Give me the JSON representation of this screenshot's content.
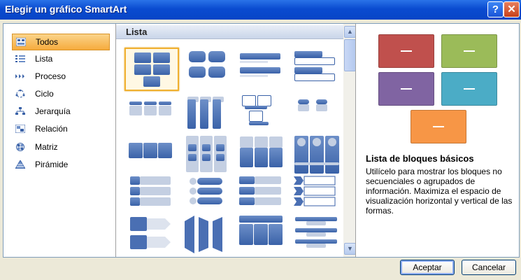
{
  "window": {
    "title": "Elegir un gráfico SmartArt",
    "help_glyph": "?",
    "close_glyph": "✕"
  },
  "categories": [
    {
      "label": "Todos",
      "icon": "all-layouts-icon",
      "selected": true
    },
    {
      "label": "Lista",
      "icon": "list-icon",
      "selected": false
    },
    {
      "label": "Proceso",
      "icon": "process-icon",
      "selected": false
    },
    {
      "label": "Ciclo",
      "icon": "cycle-icon",
      "selected": false
    },
    {
      "label": "Jerarquía",
      "icon": "hierarchy-icon",
      "selected": false
    },
    {
      "label": "Relación",
      "icon": "relationship-icon",
      "selected": false
    },
    {
      "label": "Matriz",
      "icon": "matrix-icon",
      "selected": false
    },
    {
      "label": "Pirámide",
      "icon": "pyramid-icon",
      "selected": false
    }
  ],
  "gallery": {
    "header": "Lista"
  },
  "preview": {
    "colors": [
      "#c0504d",
      "#9bbb59",
      "#8064a2",
      "#4bacc6",
      "#f79646"
    ]
  },
  "description": {
    "title": "Lista de bloques básicos",
    "body": "Utilícelo para mostrar los bloques no secuenciales o agrupados de información. Maximiza el espacio de visualización horizontal y vertical de las formas."
  },
  "buttons": {
    "ok": "Aceptar",
    "cancel": "Cancelar"
  },
  "scroll": {
    "up_glyph": "▲",
    "down_glyph": "▼"
  }
}
